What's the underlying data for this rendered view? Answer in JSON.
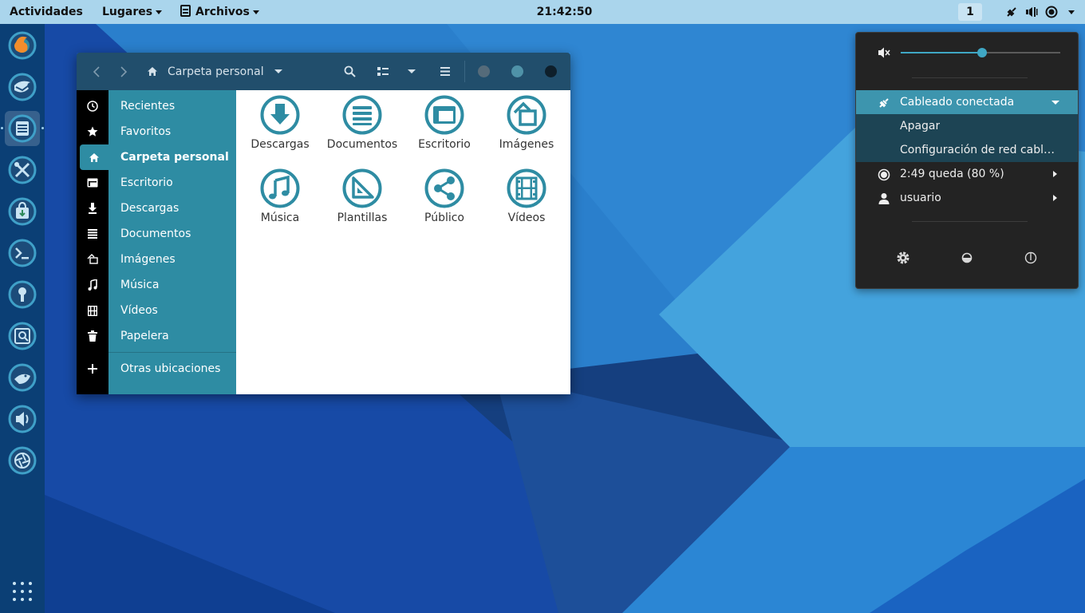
{
  "topbar": {
    "activities": "Actividades",
    "places": "Lugares",
    "app_menu": "Archivos",
    "clock": "21:42:50",
    "workspace": "1",
    "status_icons": [
      "network-wired-icon",
      "volume-icon",
      "battery-icon",
      "chevron-down-icon"
    ]
  },
  "dock": {
    "items": [
      "firefox-icon",
      "thunderbird-icon",
      "files-icon",
      "settings-tools-icon",
      "software-store-icon",
      "terminal-icon",
      "passwords-keys-icon",
      "image-viewer-icon",
      "tweaks-icon",
      "sound-icon",
      "camera-aperture-icon"
    ],
    "active_index": 2,
    "show_apps": "grid-icon"
  },
  "files_window": {
    "path": "Carpeta personal",
    "sidebar": [
      {
        "label": "Recientes",
        "icon": "clock-icon"
      },
      {
        "label": "Favoritos",
        "icon": "star-icon"
      },
      {
        "label": "Carpeta personal",
        "icon": "home-icon",
        "selected": true
      },
      {
        "label": "Escritorio",
        "icon": "desktop-icon"
      },
      {
        "label": "Descargas",
        "icon": "download-icon"
      },
      {
        "label": "Documentos",
        "icon": "document-icon"
      },
      {
        "label": "Imágenes",
        "icon": "image-icon"
      },
      {
        "label": "Música",
        "icon": "music-icon"
      },
      {
        "label": "Vídeos",
        "icon": "video-icon"
      },
      {
        "label": "Papelera",
        "icon": "trash-icon"
      }
    ],
    "other_locations": "Otras ubicaciones",
    "folders": [
      {
        "label": "Descargas",
        "icon": "download-folder-icon"
      },
      {
        "label": "Documentos",
        "icon": "documents-folder-icon"
      },
      {
        "label": "Escritorio",
        "icon": "desktop-folder-icon"
      },
      {
        "label": "Imágenes",
        "icon": "pictures-folder-icon"
      },
      {
        "label": "Música",
        "icon": "music-folder-icon"
      },
      {
        "label": "Plantillas",
        "icon": "templates-folder-icon"
      },
      {
        "label": "Público",
        "icon": "public-folder-icon"
      },
      {
        "label": "Vídeos",
        "icon": "videos-folder-icon"
      }
    ]
  },
  "system_menu": {
    "volume_percent": 51,
    "network": "Cableado conectada",
    "network_off": "Apagar",
    "network_settings": "Configuración de red cableada",
    "battery": "2:49 queda (80 %)",
    "user": "usuario",
    "bottom_buttons": [
      "settings-icon",
      "lock-orientation-icon",
      "power-icon"
    ]
  },
  "colors": {
    "accent": "#2e8ca3",
    "headerbar": "#214e6c",
    "topbar": "#aad5ec",
    "menu_bg": "#232323"
  }
}
